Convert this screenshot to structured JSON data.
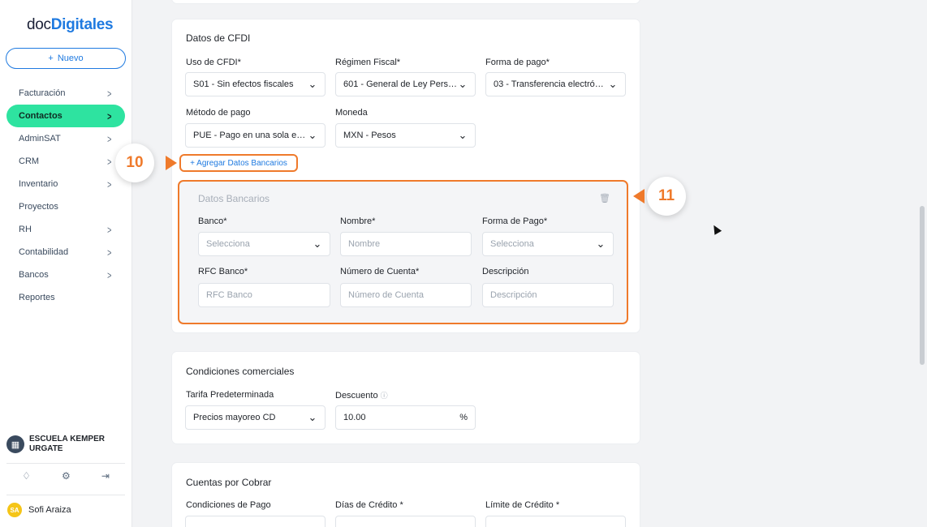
{
  "sidebar": {
    "logo": {
      "prefix": "doc",
      "brand": "Digitales"
    },
    "new_button": {
      "icon": "+",
      "label": "Nuevo"
    },
    "items": [
      {
        "label": "Facturación",
        "has_children": true,
        "active": false
      },
      {
        "label": "Contactos",
        "has_children": true,
        "active": true
      },
      {
        "label": "AdminSAT",
        "has_children": true,
        "active": false
      },
      {
        "label": "CRM",
        "has_children": true,
        "active": false
      },
      {
        "label": "Inventario",
        "has_children": true,
        "active": false
      },
      {
        "label": "Proyectos",
        "has_children": false,
        "active": false
      },
      {
        "label": "RH",
        "has_children": true,
        "active": false
      },
      {
        "label": "Contabilidad",
        "has_children": true,
        "active": false
      },
      {
        "label": "Bancos",
        "has_children": true,
        "active": false
      },
      {
        "label": "Reportes",
        "has_children": false,
        "active": false
      }
    ],
    "organization": {
      "name": "ESCUELA KEMPER URGATE"
    },
    "user": {
      "initials": "SA",
      "name": "Sofi Araiza"
    }
  },
  "cfdi": {
    "title": "Datos de CFDI",
    "uso_cfdi": {
      "label": "Uso de CFDI*",
      "value": "S01 - Sin efectos fiscales"
    },
    "regimen": {
      "label": "Régimen Fiscal*",
      "value": "601 - General de Ley Perso..."
    },
    "forma_pago": {
      "label": "Forma de pago*",
      "value": "03 - Transferencia electróni..."
    },
    "metodo_pago": {
      "label": "Método de pago",
      "value": "PUE - Pago en una sola exh..."
    },
    "moneda": {
      "label": "Moneda",
      "value": "MXN - Pesos"
    },
    "add_bank_label": "+ Agregar Datos Bancarios"
  },
  "bank": {
    "title": "Datos Bancarios",
    "banco": {
      "label": "Banco*",
      "placeholder": "Selecciona"
    },
    "nombre": {
      "label": "Nombre*",
      "placeholder": "Nombre"
    },
    "forma_pago": {
      "label": "Forma de Pago*",
      "placeholder": "Selecciona"
    },
    "rfc": {
      "label": "RFC Banco*",
      "placeholder": "RFC Banco"
    },
    "cuenta": {
      "label": "Número de Cuenta*",
      "placeholder": "Número de Cuenta"
    },
    "descripcion": {
      "label": "Descripción",
      "placeholder": "Descripción"
    }
  },
  "comerciales": {
    "title": "Condiciones comerciales",
    "tarifa": {
      "label": "Tarifa Predeterminada",
      "value": "Precios mayoreo CD"
    },
    "descuento": {
      "label": "Descuento",
      "value": "10.00",
      "unit": "%"
    }
  },
  "cobrar": {
    "title": "Cuentas por Cobrar",
    "condiciones_label": "Condiciones de Pago",
    "dias_label": "Días de Crédito *",
    "limite_label": "Límite de Crédito *"
  },
  "callouts": {
    "first": "10",
    "second": "11"
  },
  "colors": {
    "accent": "#1f7ae0",
    "active_nav": "#2ee3a0",
    "highlight": "#ef7a2b"
  }
}
